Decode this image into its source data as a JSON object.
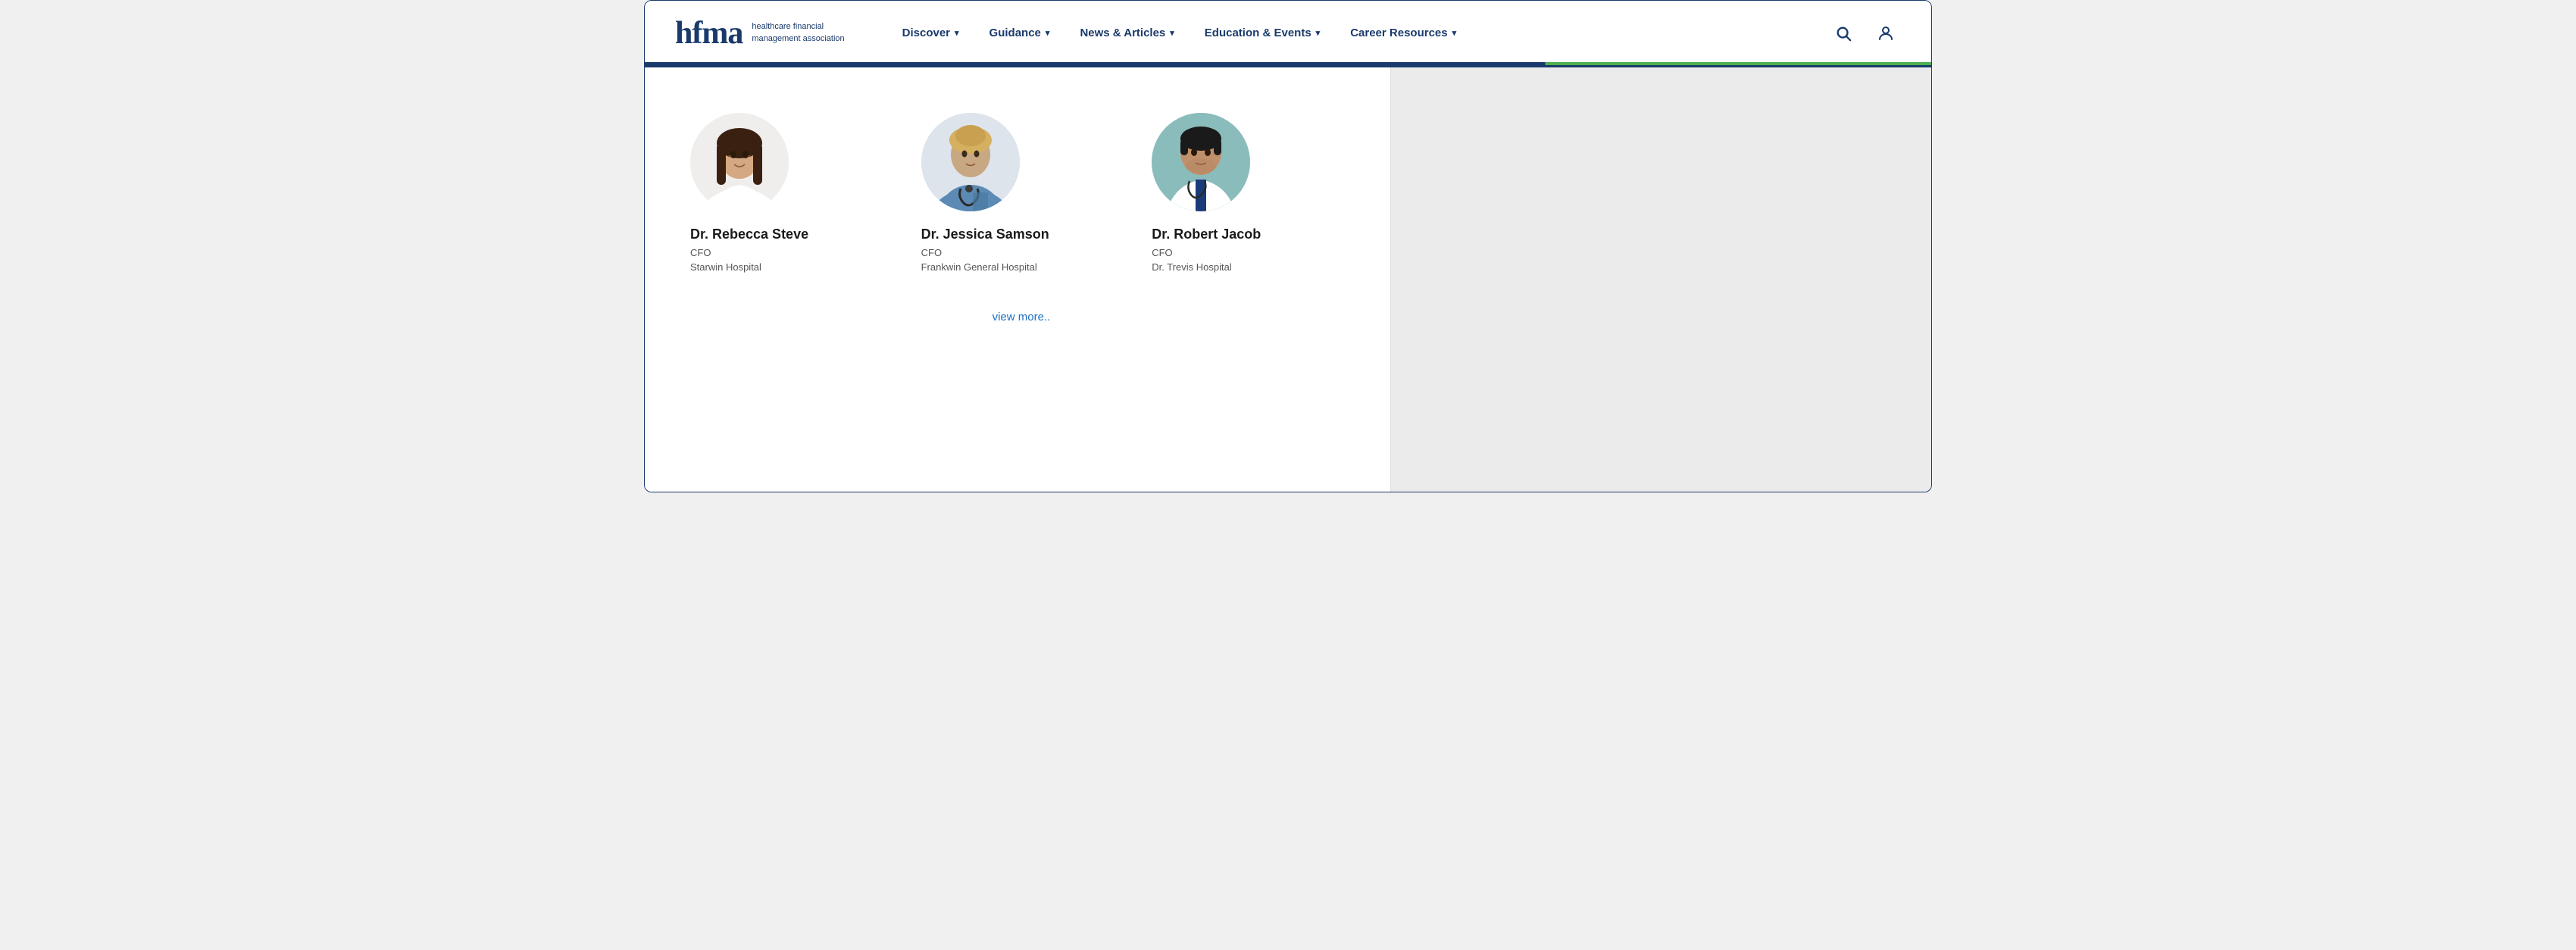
{
  "page": {
    "title": "HFMA - Healthcare Financial Management Association"
  },
  "header": {
    "logo": {
      "text": "hfma",
      "subtitle": "healthcare financial\nmanagement association"
    },
    "nav": [
      {
        "label": "Discover",
        "has_dropdown": true
      },
      {
        "label": "Guidance",
        "has_dropdown": true
      },
      {
        "label": "News & Articles",
        "has_dropdown": true
      },
      {
        "label": "Education & Events",
        "has_dropdown": true
      },
      {
        "label": "Career Resources",
        "has_dropdown": true
      }
    ],
    "search_icon": "🔍",
    "user_icon": "👤"
  },
  "profiles": [
    {
      "name": "Dr. Rebecca Steve",
      "role": "CFO",
      "org": "Starwin Hospital",
      "avatar_alt": "Female doctor in white coat"
    },
    {
      "name": "Dr. Jessica Samson",
      "role": "CFO",
      "org": "Frankwin General Hospital",
      "avatar_alt": "Female doctor with stethoscope"
    },
    {
      "name": "Dr. Robert Jacob",
      "role": "CFO",
      "org": "Dr. Trevis Hospital",
      "avatar_alt": "Male doctor in white coat"
    }
  ],
  "view_more_label": "view more..",
  "colors": {
    "primary": "#1a3a6b",
    "accent_green": "#4caf50",
    "link": "#1d6fbf"
  }
}
